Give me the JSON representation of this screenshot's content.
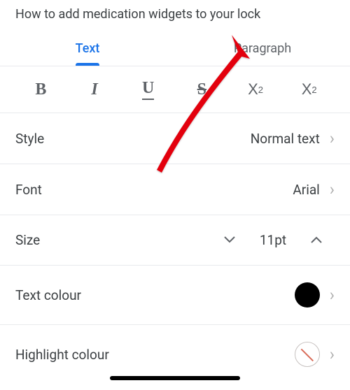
{
  "document": {
    "title": "How to add medication widgets to your lock"
  },
  "tabs": {
    "text": "Text",
    "paragraph": "Paragraph"
  },
  "format": {
    "bold": "B",
    "italic": "I",
    "underline": "U",
    "strike": "S",
    "superscript": "X",
    "superscript_sm": "2",
    "subscript": "X",
    "subscript_sm": "2"
  },
  "rows": {
    "style_label": "Style",
    "style_value": "Normal text",
    "font_label": "Font",
    "font_value": "Arial",
    "size_label": "Size",
    "size_value": "11pt",
    "text_colour_label": "Text colour",
    "highlight_colour_label": "Highlight colour"
  },
  "colors": {
    "text_colour": "#000000"
  }
}
